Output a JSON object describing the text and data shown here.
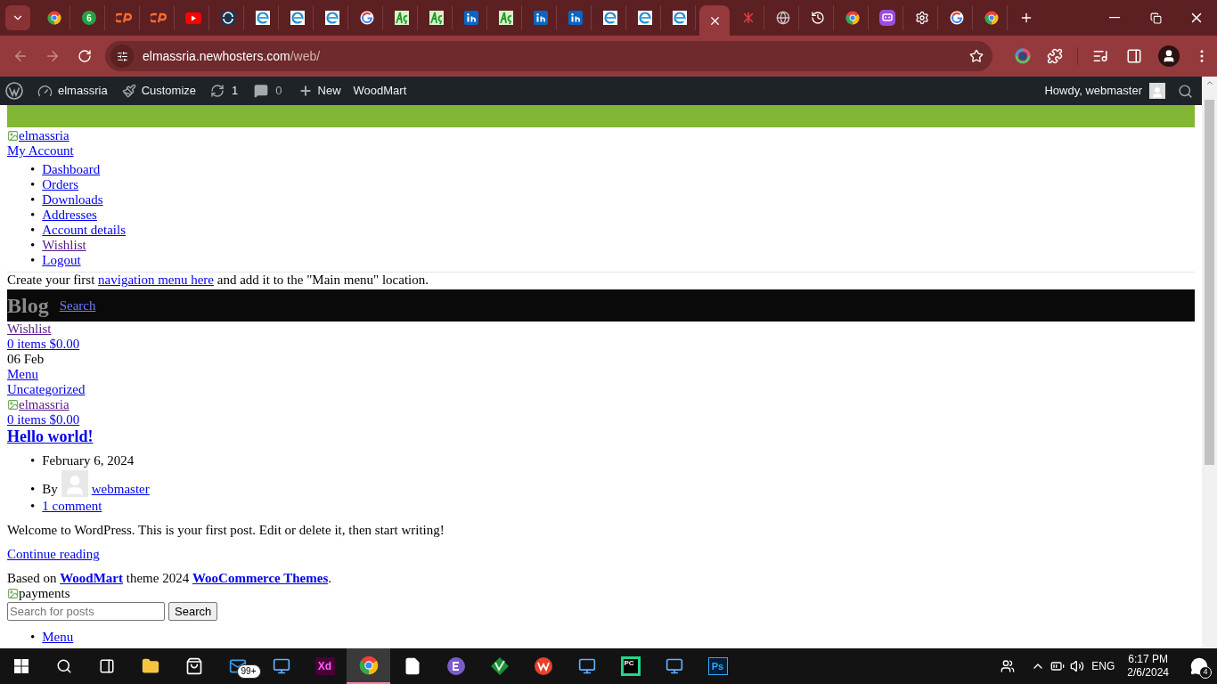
{
  "browser": {
    "tabs": [
      {
        "kind": "chrome",
        "selected": false
      },
      {
        "kind": "whatsapp",
        "badge": "6",
        "selected": false
      },
      {
        "kind": "cpanel",
        "selected": false
      },
      {
        "kind": "cpanel",
        "selected": false
      },
      {
        "kind": "youtube",
        "selected": false
      },
      {
        "kind": "shield",
        "selected": false
      },
      {
        "kind": "edge-e",
        "selected": false
      },
      {
        "kind": "edge-e",
        "selected": false
      },
      {
        "kind": "edge-e",
        "selected": false
      },
      {
        "kind": "google",
        "selected": false
      },
      {
        "kind": "green-logo",
        "selected": false
      },
      {
        "kind": "green-logo",
        "selected": false
      },
      {
        "kind": "linkedin",
        "selected": false
      },
      {
        "kind": "green-logo",
        "selected": false
      },
      {
        "kind": "linkedin",
        "selected": false
      },
      {
        "kind": "linkedin",
        "selected": false
      },
      {
        "kind": "edge-e",
        "selected": false
      },
      {
        "kind": "edge-e",
        "selected": false
      },
      {
        "kind": "edge-e",
        "selected": false
      },
      {
        "kind": "blank",
        "selected": true
      },
      {
        "kind": "crossed",
        "selected": false
      },
      {
        "kind": "globe",
        "selected": false
      },
      {
        "kind": "history",
        "selected": false
      },
      {
        "kind": "chrome",
        "selected": false
      },
      {
        "kind": "chat",
        "selected": false
      },
      {
        "kind": "settings",
        "selected": false
      },
      {
        "kind": "google",
        "selected": false
      },
      {
        "kind": "chrome",
        "selected": false
      }
    ],
    "address": {
      "host": "elmassria.newhosters.com",
      "path": "/web/"
    }
  },
  "admin_bar": {
    "site": "elmassria",
    "customize": "Customize",
    "updates": "1",
    "comments": "0",
    "new": "New",
    "theme": "WoodMart",
    "greeting": "Howdy, webmaster"
  },
  "page": {
    "logo_alt": "elmassria",
    "account_link": "My Account",
    "account_menu": [
      {
        "marker": "•",
        "text": "Dashboard",
        "visited": false
      },
      {
        "marker": "•",
        "text": "Orders",
        "visited": false
      },
      {
        "marker": "•",
        "text": "Downloads",
        "visited": false
      },
      {
        "marker": "•",
        "text": "Addresses",
        "visited": false
      },
      {
        "marker": "•",
        "text": "Account details",
        "visited": false
      },
      {
        "marker": "•",
        "text": "Wishlist",
        "visited": true
      },
      {
        "marker": "•",
        "text": "Logout",
        "visited": false
      }
    ],
    "nav_notice": {
      "before": "Create your first",
      "link": "navigation menu here",
      "after": "and add it to the \"Main menu\" location."
    },
    "title": "Blog",
    "search_link": "Search",
    "header_items": [
      {
        "kind": "link",
        "text": "Wishlist",
        "visited": true
      },
      {
        "kind": "link",
        "text": "0 items $0.00",
        "visited": false
      },
      {
        "kind": "text",
        "text": "06 Feb"
      },
      {
        "kind": "link",
        "text": "Menu",
        "visited": false
      },
      {
        "kind": "link",
        "text": "Uncategorized",
        "visited": false
      },
      {
        "kind": "image",
        "text": "elmassria"
      },
      {
        "kind": "link",
        "text": "0 items $0.00",
        "visited": false
      }
    ],
    "post": {
      "title": "Hello world!",
      "meta": [
        {
          "marker": "•",
          "kind": "date",
          "text": "February 6, 2024"
        },
        {
          "marker": "•",
          "kind": "author",
          "by": "By",
          "text": "webmaster"
        },
        {
          "marker": "•",
          "kind": "comments",
          "text": "1 comment"
        }
      ],
      "excerpt": "Welcome to WordPress. This is your first post. Edit or delete it, then start writing!",
      "more": "Continue reading"
    },
    "footer": {
      "prefix": "Based on",
      "link1": "WoodMart",
      "middle": "theme 2024",
      "link2": "WooCommerce Themes",
      "suffix": "."
    },
    "payments_alt": "payments",
    "search": {
      "placeholder": "Search for posts",
      "button": "Search"
    },
    "bottom_menu": [
      {
        "marker": "•",
        "text": "Menu"
      }
    ]
  },
  "taskbar": {
    "apps": [
      {
        "kind": "explorer",
        "selected": false
      },
      {
        "kind": "store",
        "selected": false
      },
      {
        "kind": "mail",
        "badge": "99+",
        "selected": false
      },
      {
        "kind": "window",
        "selected": false
      },
      {
        "kind": "xd",
        "label": "Xd",
        "selected": false
      },
      {
        "kind": "chrome",
        "selected": true
      },
      {
        "kind": "file",
        "selected": false
      },
      {
        "kind": "purple",
        "selected": false
      },
      {
        "kind": "vim",
        "selected": false
      },
      {
        "kind": "wps",
        "selected": false
      },
      {
        "kind": "window",
        "selected": false
      },
      {
        "kind": "pycharm",
        "label": "PC",
        "selected": false
      },
      {
        "kind": "window",
        "selected": false
      },
      {
        "kind": "ps",
        "label": "Ps",
        "selected": false
      }
    ],
    "language": "ENG",
    "time": "6:17 PM",
    "date": "2/6/2024",
    "notifications": "4"
  }
}
